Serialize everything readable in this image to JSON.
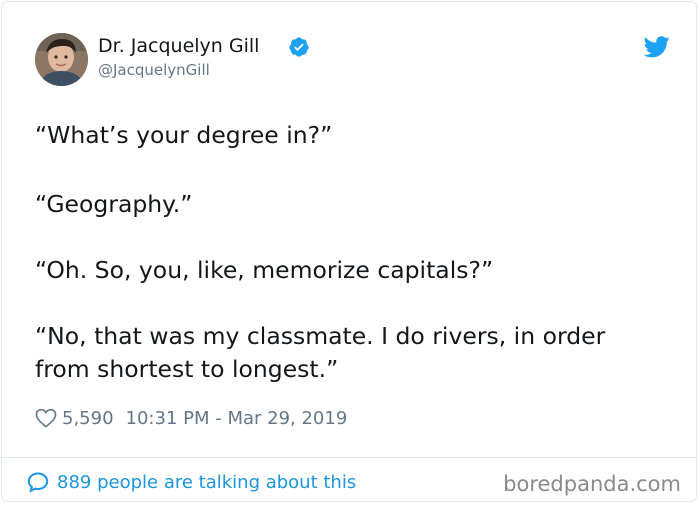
{
  "tweet": {
    "author": {
      "display_name": "Dr. Jacquelyn Gill",
      "handle": "@JacquelynGill",
      "verified": true,
      "avatar_icon": "avatar-photo"
    },
    "brand_icon": "twitter-bird-icon",
    "lines": [
      "“What’s your degree in?”",
      "“Geography.”",
      "“Oh. So, you, like, memorize capitals?”",
      "“No, that was my classmate. I do rivers, in order",
      "from shortest to longest.”"
    ],
    "likes": "5,590",
    "timestamp": "10:31 PM - Mar 29, 2019",
    "talking": "889 people are talking about this"
  },
  "watermark": "boredpanda.com",
  "colors": {
    "twitter_blue": "#1da1f2",
    "link_blue": "#1b95e0",
    "muted_gray": "#657786",
    "text": "#14171a",
    "border": "#e1e8ed"
  }
}
